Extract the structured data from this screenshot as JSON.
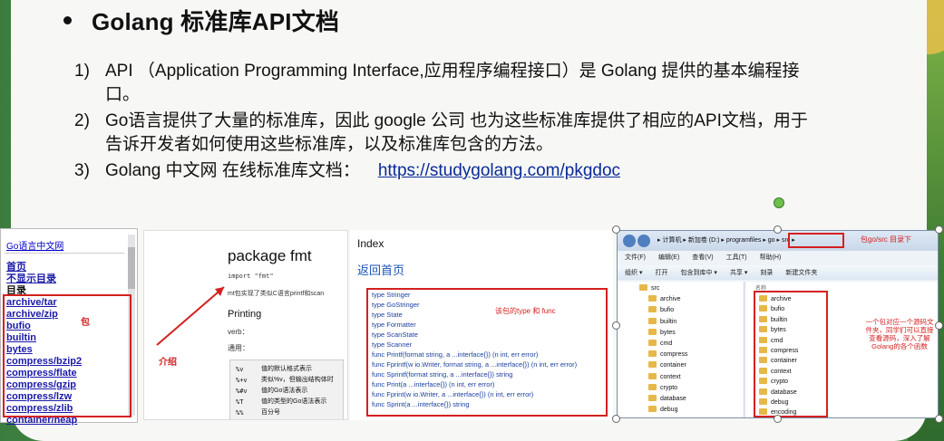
{
  "slide": {
    "title": "Golang 标准库API文档",
    "items": [
      {
        "num": "1)",
        "text": "API （Application Programming Interface,应用程序编程接口）是 Golang 提供的基本编程接口。"
      },
      {
        "num": "2)",
        "text": "Go语言提供了大量的标准库，因此 google 公司 也为这些标准库提供了相应的API文档，用于告诉开发者如何使用这些标准库，以及标准库包含的方法。"
      },
      {
        "num": "3)",
        "text": "Golang 中文网 在线标准库文档：",
        "link": "https://studygolang.com/pkgdoc"
      }
    ]
  },
  "panel_site": {
    "title": "Go语言中文网",
    "links": [
      "首页",
      "不显示目录"
    ],
    "section": "目录",
    "packages": [
      "archive/tar",
      "archive/zip",
      "bufio",
      "builtin",
      "bytes",
      "compress/bzip2",
      "compress/flate",
      "compress/gzip",
      "compress/lzw",
      "compress/zlib",
      "container/heap"
    ],
    "note": "包"
  },
  "panel_fmt": {
    "heading": "package fmt",
    "import": "import \"fmt\"",
    "desc": "mt包实现了类似C语言printf和scan",
    "printing": "Printing",
    "verb": "verb：",
    "general": "通用：",
    "table": [
      {
        "k": "%v",
        "v": "值的默认格式表示"
      },
      {
        "k": "%+v",
        "v": "类似%v，但输出结构体时"
      },
      {
        "k": "%#v",
        "v": "值的Go语法表示"
      },
      {
        "k": "%T",
        "v": "值的类型的Go语法表示"
      },
      {
        "k": "%%",
        "v": "百分号"
      }
    ],
    "note": "介绍"
  },
  "panel_index": {
    "heading": "Index",
    "home": "返回首页",
    "entries": [
      "type Stringer",
      "type GoStringer",
      "type State",
      "type Formatter",
      "type ScanState",
      "type Scanner",
      "func Printf(format string, a ...interface{}) (n int, err error)",
      "func Fprintf(w io.Writer, format string, a ...interface{}) (n int, err error)",
      "func Sprintf(format string, a ...interface{}) string",
      "func Print(a ...interface{}) (n int, err error)",
      "func Fprint(w io.Writer, a ...interface{}) (n int, err error)",
      "func Sprint(a ...interface{}) string"
    ],
    "note": "该包的type 和 func"
  },
  "panel_explorer": {
    "path": "▸ 计算机 ▸ 新加卷 (D:) ▸ programfiles ▸ go ▸ src ▸",
    "path_note": "包go/src 目录下",
    "menu": [
      "文件(F)",
      "编辑(E)",
      "查看(V)",
      "工具(T)",
      "帮助(H)"
    ],
    "toolbar": [
      "组织 ▾",
      "打开",
      "包含到库中 ▾",
      "共享 ▾",
      "刻录",
      "新建文件夹"
    ],
    "tree": [
      "src",
      "archive",
      "bufio",
      "builtin",
      "bytes",
      "cmd",
      "compress",
      "container",
      "context",
      "crypto",
      "database",
      "debug"
    ],
    "column": "名称",
    "files": [
      "archive",
      "bufio",
      "builtin",
      "bytes",
      "cmd",
      "compress",
      "container",
      "context",
      "crypto",
      "database",
      "debug",
      "encoding"
    ],
    "note": "一个包对应一个源码文件夹，同学们可以直接查看源码，深入了解Golang的各个函数"
  }
}
